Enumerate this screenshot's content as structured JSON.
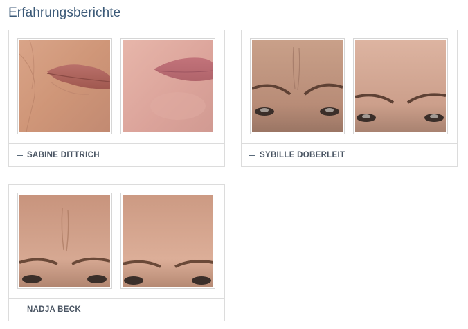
{
  "section": {
    "title": "Erfahrungsberichte"
  },
  "testimonials": [
    {
      "name": "SABINE DITTRICH",
      "before_image": "lips-before-photo",
      "after_image": "lips-after-photo"
    },
    {
      "name": "SYBILLE DOBERLEIT",
      "before_image": "forehead-before-photo",
      "after_image": "forehead-after-photo"
    },
    {
      "name": "NADJA BECK",
      "before_image": "brow-before-photo",
      "after_image": "brow-after-photo"
    }
  ],
  "colors": {
    "title": "#3c5a78",
    "name": "#4a5563",
    "border": "#dcdcdc"
  }
}
